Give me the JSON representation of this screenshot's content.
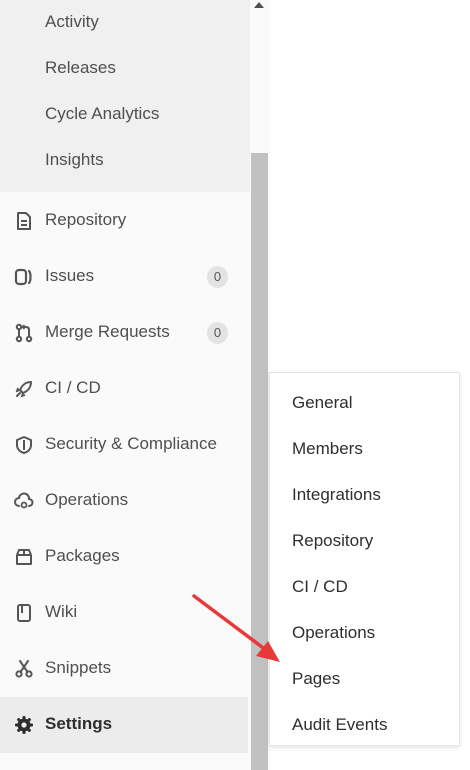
{
  "submenu": {
    "items": [
      {
        "label": "Activity"
      },
      {
        "label": "Releases"
      },
      {
        "label": "Cycle Analytics"
      },
      {
        "label": "Insights"
      }
    ]
  },
  "nav": {
    "items": [
      {
        "label": "Repository",
        "icon": "document-icon"
      },
      {
        "label": "Issues",
        "icon": "issues-icon",
        "count": "0"
      },
      {
        "label": "Merge Requests",
        "icon": "merge-request-icon",
        "count": "0"
      },
      {
        "label": "CI / CD",
        "icon": "rocket-icon"
      },
      {
        "label": "Security & Compliance",
        "icon": "shield-icon"
      },
      {
        "label": "Operations",
        "icon": "cloud-gear-icon"
      },
      {
        "label": "Packages",
        "icon": "package-icon"
      },
      {
        "label": "Wiki",
        "icon": "book-icon"
      },
      {
        "label": "Snippets",
        "icon": "scissors-icon"
      },
      {
        "label": "Settings",
        "icon": "gear-icon",
        "active": true
      }
    ]
  },
  "settings_flyout": {
    "items": [
      {
        "label": "General"
      },
      {
        "label": "Members"
      },
      {
        "label": "Integrations"
      },
      {
        "label": "Repository"
      },
      {
        "label": "CI / CD"
      },
      {
        "label": "Operations"
      },
      {
        "label": "Pages"
      },
      {
        "label": "Audit Events"
      }
    ]
  },
  "colors": {
    "sidebar_bg": "#fafafa",
    "submenu_bg": "#f0f0f0",
    "active_bg": "#ececec",
    "annotation_arrow": "#e8393a"
  }
}
